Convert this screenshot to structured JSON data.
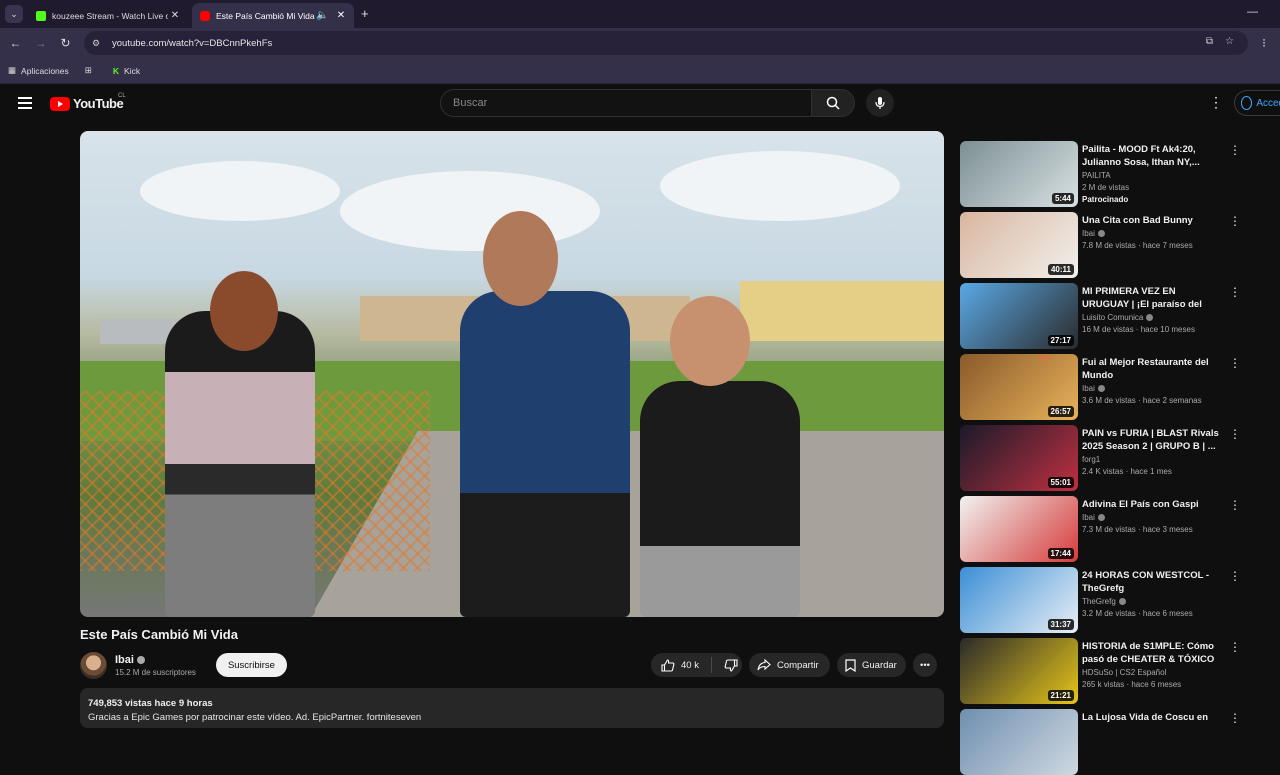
{
  "browser": {
    "tabs": [
      {
        "title": "kouzeee Stream - Watch Live o",
        "favicon_color": "#53fc18"
      },
      {
        "title": "Este País Cambió Mi Vida -",
        "favicon_color": "#ff0000"
      }
    ],
    "url": "youtube.com/watch?v=DBCnnPkehFs",
    "bookmarks": [
      {
        "label": "Aplicaciones"
      },
      {
        "label": "Kick"
      }
    ]
  },
  "header": {
    "logo_text": "YouTube",
    "country": "CL",
    "search_placeholder": "Buscar",
    "signin_label": "Acceder"
  },
  "video": {
    "title": "Este País Cambió Mi Vida",
    "channel": "Ibai",
    "subscribers": "15.2 M de suscriptores",
    "subscribe_label": "Suscribirse",
    "likes": "40 k",
    "share_label": "Compartir",
    "save_label": "Guardar",
    "description": {
      "meta": "749,853 vistas  hace 9 horas",
      "line": "Gracias a Epic Games por patrocinar este vídeo. Ad. EpicPartner. fortniteseven"
    }
  },
  "related": [
    {
      "title": "Pailita - MOOD Ft Ak4:20, Julianno Sosa, Ithan NY,...",
      "channel": "PAILITA",
      "views": "2 M de vistas",
      "badge": "Patrocinado",
      "duration": "5:44",
      "verified": false,
      "thumb_colors": [
        "#7d8f93",
        "#d7e1e3"
      ]
    },
    {
      "title": "Una Cita con Bad Bunny",
      "channel": "Ibai",
      "views": "7.8 M de vistas · hace 7 meses",
      "duration": "40:11",
      "verified": true,
      "thumb_colors": [
        "#d9b6a0",
        "#f1f0ec"
      ]
    },
    {
      "title": "MI PRIMERA VEZ EN URUGUAY | ¡El paraíso del mate, futbol y ...",
      "channel": "Luisito Comunica",
      "views": "16 M de vistas · hace 10 meses",
      "duration": "27:17",
      "verified": true,
      "thumb_colors": [
        "#5aa9e6",
        "#2a2a2a"
      ]
    },
    {
      "title": "Fui al Mejor Restaurante del Mundo",
      "channel": "Ibai",
      "views": "3.6 M de vistas · hace 2 semanas",
      "duration": "26:57",
      "verified": true,
      "badge_top": "Perú",
      "thumb_colors": [
        "#8a5a2b",
        "#e8b25a"
      ]
    },
    {
      "title": "PAIN vs FURIA | BLAST Rivals 2025 Season 2 | GRUPO B | ...",
      "channel": "forg1",
      "views": "2.4 K vistas · hace 1 mes",
      "duration": "55:01",
      "verified": false,
      "thumb_colors": [
        "#1a1a2a",
        "#c03040"
      ]
    },
    {
      "title": "Adivina El País con Gaspi",
      "channel": "Ibai",
      "views": "7.3 M de vistas · hace 3 meses",
      "duration": "17:44",
      "verified": true,
      "thumb_colors": [
        "#f2f2f2",
        "#d63a3a"
      ]
    },
    {
      "title": "24 HORAS CON WESTCOL - TheGrefg",
      "channel": "TheGrefg",
      "views": "3.2 M de vistas · hace 6 meses",
      "duration": "31:37",
      "verified": true,
      "thumb_colors": [
        "#3b8fd6",
        "#e9eef5"
      ]
    },
    {
      "title": "HISTORIA de S1MPLE: Cómo pasó de CHEATER & TÓXICO a...",
      "channel": "HDSuSo | CS2 Español",
      "views": "265 k vistas · hace 6 meses",
      "duration": "21:21",
      "verified": false,
      "thumb_colors": [
        "#2a2a2a",
        "#e6c51a"
      ]
    },
    {
      "title": "La Lujosa Vida de Coscu en",
      "channel": "",
      "views": "",
      "duration": "",
      "verified": false,
      "thumb_colors": [
        "#6f8fb0",
        "#cfd8e0"
      ]
    }
  ]
}
